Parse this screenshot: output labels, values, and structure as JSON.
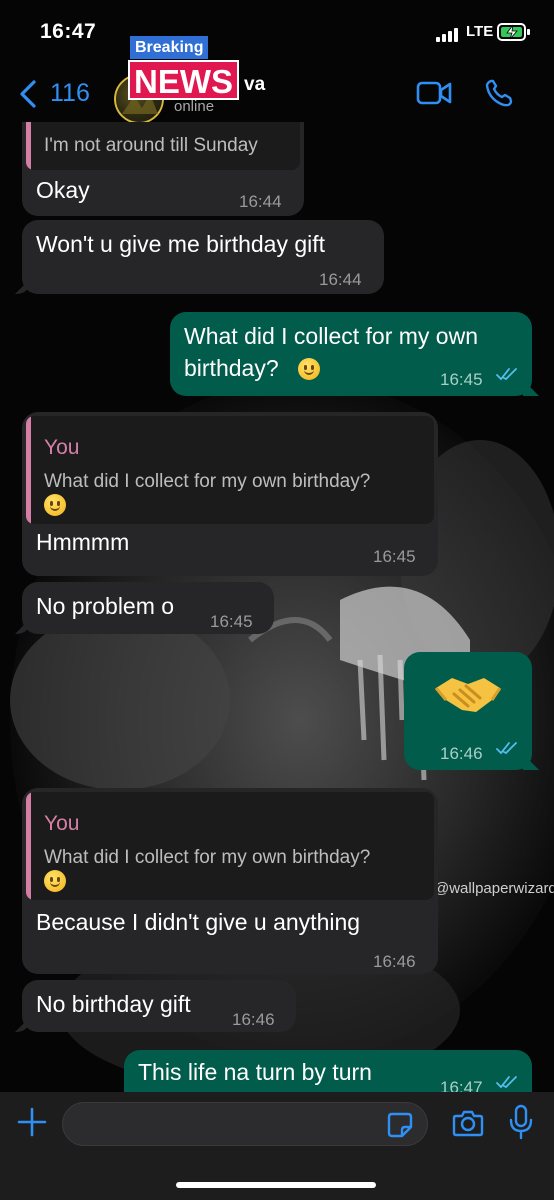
{
  "status_bar": {
    "time": "16:47",
    "network": "LTE"
  },
  "header": {
    "back_count": "116",
    "contact_name_fragment": "va",
    "contact_status": "online",
    "overlay_breaking": "Breaking",
    "overlay_news": "NEWS"
  },
  "wallpaper": {
    "watermark": "@wallpaperwizard"
  },
  "messages": [
    {
      "id": "m0",
      "direction": "incoming",
      "quote_text": "I'm not around till Sunday",
      "text": "Okay",
      "time": "16:44"
    },
    {
      "id": "m1",
      "direction": "incoming",
      "text": "Won't u give me birthday gift",
      "time": "16:44"
    },
    {
      "id": "m2",
      "direction": "outgoing",
      "text_line1": "What did I collect for my own",
      "text_line2": "birthday?",
      "emoji": "slightly-smiling-face",
      "time": "16:45",
      "read": true
    },
    {
      "id": "m3",
      "direction": "incoming",
      "quote_author": "You",
      "quote_text": "What did I collect for my own birthday?",
      "quote_emoji": "slightly-smiling-face",
      "text": "Hmmmm",
      "time": "16:45"
    },
    {
      "id": "m4",
      "direction": "incoming",
      "text": "No problem o",
      "time": "16:45"
    },
    {
      "id": "m5",
      "direction": "outgoing",
      "emoji": "handshake",
      "time": "16:46",
      "read": true
    },
    {
      "id": "m6",
      "direction": "incoming",
      "quote_author": "You",
      "quote_text": "What did I collect for my own birthday?",
      "quote_emoji": "slightly-smiling-face",
      "text": "Because I didn't give u anything",
      "time": "16:46"
    },
    {
      "id": "m7",
      "direction": "incoming",
      "text": "No birthday gift",
      "time": "16:46"
    },
    {
      "id": "m8",
      "direction": "outgoing",
      "text": "This life na turn by turn",
      "time": "16:47",
      "read": true
    }
  ],
  "input_bar": {
    "message_value": "",
    "icons": [
      "plus-icon",
      "sticker-icon",
      "camera-icon",
      "microphone-icon"
    ]
  },
  "colors": {
    "accent": "#2f8ff2",
    "incoming_bubble": "#262628",
    "outgoing_bubble": "#025c4c",
    "quote_author": "#d67fa6",
    "read_ticks": "#53bdeb",
    "news_red": "#e0184f",
    "breaking_blue": "#2f6fd6"
  }
}
